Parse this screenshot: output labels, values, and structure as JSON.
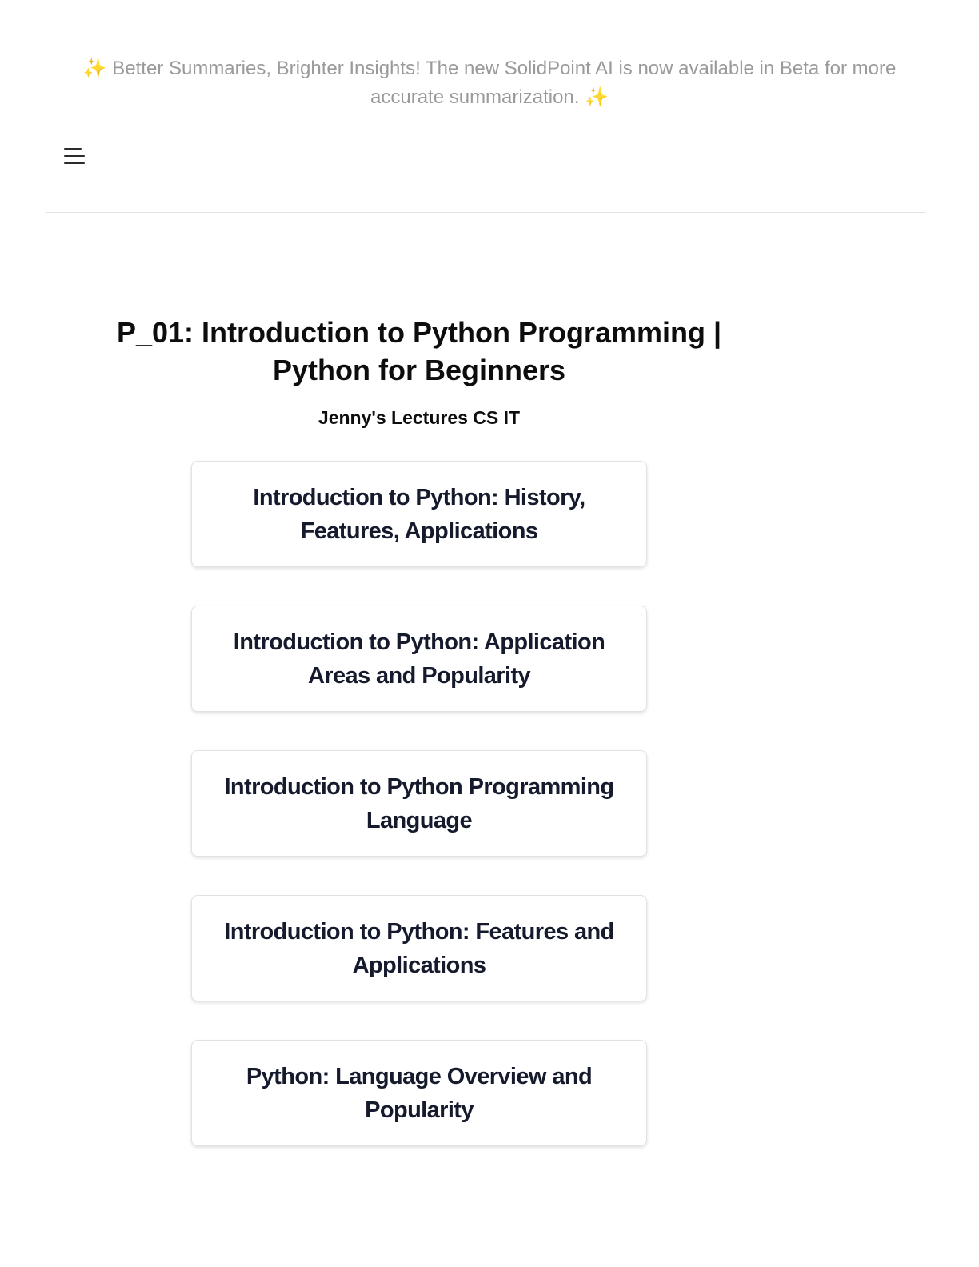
{
  "banner": {
    "text": "Better Summaries, Brighter Insights! The new SolidPoint AI is now available in Beta for more accurate summarization.",
    "sparkle": "✨"
  },
  "header": {
    "menu_icon": "hamburger-menu-icon"
  },
  "video": {
    "title": "P_01: Introduction to Python Programming | Python for Beginners",
    "author": "Jenny's Lectures CS IT"
  },
  "chapters": [
    {
      "title": "Introduction to Python: History, Features, Applications"
    },
    {
      "title": "Introduction to Python: Application Areas and Popularity"
    },
    {
      "title": "Introduction to Python Programming Language"
    },
    {
      "title": "Introduction to Python: Features and Applications"
    },
    {
      "title": "Python: Language Overview and Popularity"
    }
  ],
  "colors": {
    "banner_text": "#9a9a9a",
    "card_text": "#151a2d",
    "card_border": "#e2e2e2"
  }
}
